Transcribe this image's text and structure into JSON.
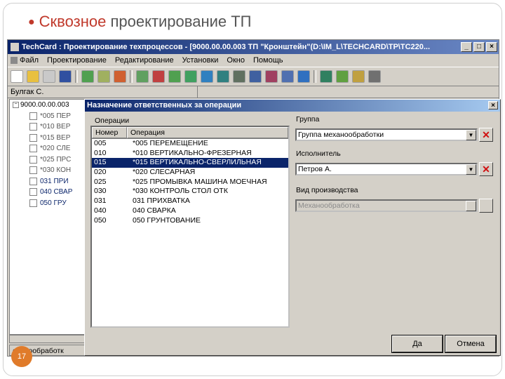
{
  "slide": {
    "title_accent": "Сквозное",
    "title_rest": "проектирование ТП",
    "page_number": "17"
  },
  "app": {
    "window_title": "TechCard : Проектирование техпроцессов - [9000.00.00.003 ТП \"Кронштейн\"(D:\\IM_L\\TECHCARD\\TP\\TC220...",
    "window_buttons": [
      "_",
      "□",
      "×"
    ],
    "menu": [
      "Файл",
      "Проектирование",
      "Редактирование",
      "Установки",
      "Окно",
      "Помощь"
    ],
    "user": "Булгак С.",
    "tree": {
      "root": "9000.00.00.003",
      "items": [
        "*005 ПЕР",
        "*010 ВЕР",
        "*015 ВЕР",
        "*020 СЛЕ",
        "*025 ПРС",
        "*030 КОН",
        "031 ПРИ",
        "040 СВАР",
        "050 ГРУ"
      ]
    },
    "status": "еханообработк"
  },
  "dialog": {
    "title": "Назначение ответственных за операции",
    "close": "×",
    "operations_label": "Операции",
    "columns": [
      "Номер",
      "Операция"
    ],
    "rows": [
      {
        "num": "005",
        "op": "*005  ПЕРЕМЕЩЕНИЕ"
      },
      {
        "num": "010",
        "op": "*010  ВЕРТИКАЛЬНО-ФРЕЗЕРНАЯ"
      },
      {
        "num": "015",
        "op": "*015  ВЕРТИКАЛЬНО-СВЕРЛИЛЬНАЯ"
      },
      {
        "num": "020",
        "op": "*020  СЛЕСАРНАЯ"
      },
      {
        "num": "025",
        "op": "*025  ПРОМЫВКА  МАШИНА МОЕЧНАЯ"
      },
      {
        "num": "030",
        "op": "*030  КОНТРОЛЬ  СТОЛ ОТК"
      },
      {
        "num": "031",
        "op": "031  ПРИХВАТКА"
      },
      {
        "num": "040",
        "op": "040  СВАРКА"
      },
      {
        "num": "050",
        "op": "050  ГРУНТОВАНИЕ"
      }
    ],
    "selected_row": "015",
    "group_label": "Группа",
    "group_value": "Группа механообработки",
    "executor_label": "Исполнитель",
    "executor_value": "Петров А.",
    "production_label": "Вид производства",
    "production_value": "Механообработка",
    "ok_label": "Да",
    "cancel_label": "Отмена"
  }
}
